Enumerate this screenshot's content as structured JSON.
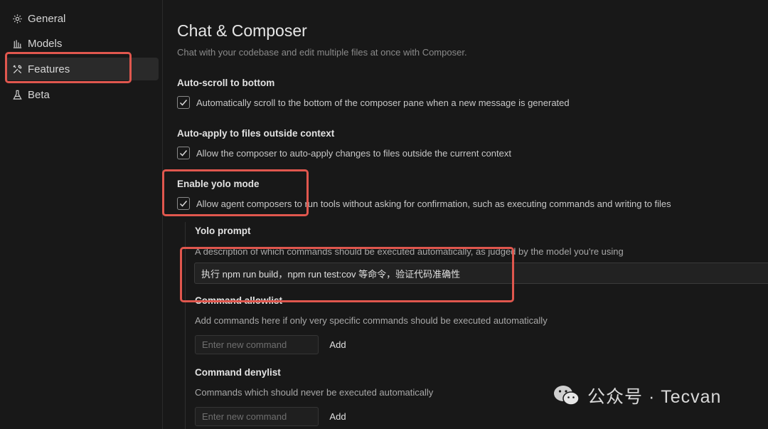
{
  "sidebar": {
    "items": [
      {
        "label": "General",
        "icon": "gear-icon"
      },
      {
        "label": "Models",
        "icon": "bar-chart-icon"
      },
      {
        "label": "Features",
        "icon": "tools-icon",
        "active": true
      },
      {
        "label": "Beta",
        "icon": "flask-icon"
      }
    ]
  },
  "page": {
    "title": "Chat & Composer",
    "subtitle": "Chat with your codebase and edit multiple files at once with Composer."
  },
  "settings": {
    "autoscroll": {
      "label": "Auto-scroll to bottom",
      "desc": "Automatically scroll to the bottom of the composer pane when a new message is generated",
      "checked": true
    },
    "autoapply": {
      "label": "Auto-apply to files outside context",
      "desc": "Allow the composer to auto-apply changes to files outside the current context",
      "checked": true
    },
    "yolo": {
      "label": "Enable yolo mode",
      "desc": "Allow agent composers to run tools without asking for confirmation, such as executing commands and writing to files",
      "checked": true
    },
    "yolo_prompt": {
      "label": "Yolo prompt",
      "desc": "A description of which commands should be executed automatically, as judged by the model you're using",
      "value": "执行 npm run build，npm run test:cov 等命令，验证代码准确性"
    },
    "allowlist": {
      "label": "Command allowlist",
      "desc": "Add commands here if only very specific commands should be executed automatically",
      "placeholder": "Enter new command",
      "add_label": "Add"
    },
    "denylist": {
      "label": "Command denylist",
      "desc": "Commands which should never be executed automatically",
      "placeholder": "Enter new command",
      "add_label": "Add"
    }
  },
  "watermark": {
    "text": "公众号 · Tecvan"
  },
  "colors": {
    "highlight": "#e0574e",
    "background": "#181818"
  }
}
